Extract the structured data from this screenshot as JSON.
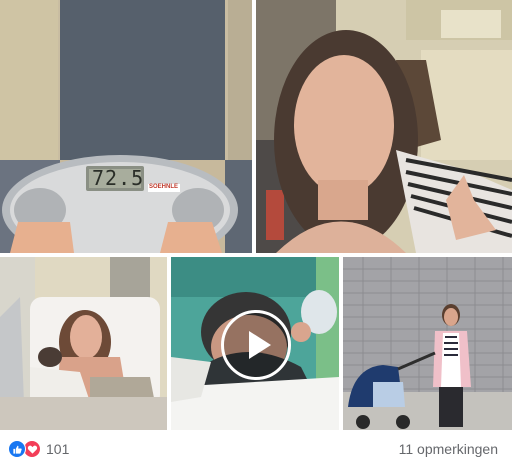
{
  "photos": [
    {
      "name": "photo-scale"
    },
    {
      "name": "photo-selfie"
    },
    {
      "name": "photo-hospital"
    },
    {
      "name": "video-baby"
    },
    {
      "name": "photo-stroller"
    }
  ],
  "scale": {
    "brand": "SOEHNLE",
    "display": "72.5"
  },
  "video": {
    "play_icon": "play-icon"
  },
  "footer": {
    "reactions_count": "101",
    "like_icon": "like-icon",
    "love_icon": "love-icon",
    "comments_label": "11 opmerkingen"
  },
  "colors": {
    "like": "#1877f2",
    "love": "#f33e58",
    "meta_text": "#65676b"
  }
}
